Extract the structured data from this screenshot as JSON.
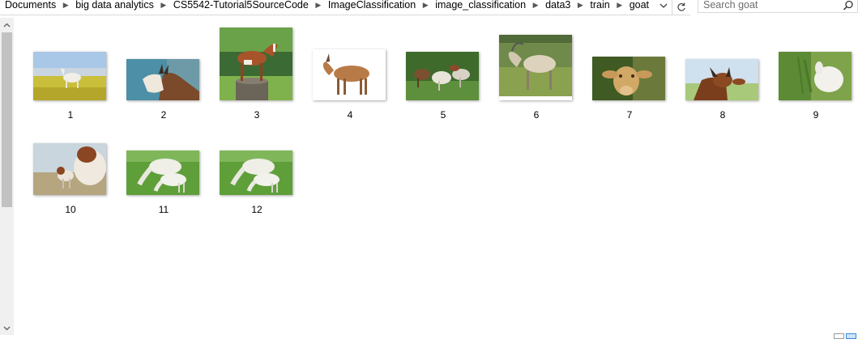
{
  "address": {
    "breadcrumbs": [
      "Documents",
      "big data analytics",
      "CS5542-Tutorial5SourceCode",
      "ImageClassification",
      "image_classification",
      "data3",
      "train",
      "goat"
    ]
  },
  "search": {
    "placeholder": "Search goat"
  },
  "files": [
    {
      "name": "1",
      "icon": "goat-on-meadow-thumbnail"
    },
    {
      "name": "2",
      "icon": "goat-head-thumbnail"
    },
    {
      "name": "3",
      "icon": "goat-on-stump-thumbnail"
    },
    {
      "name": "4",
      "icon": "brown-goat-thumbnail"
    },
    {
      "name": "5",
      "icon": "goat-group-thumbnail"
    },
    {
      "name": "6",
      "icon": "white-goat-thumbnail"
    },
    {
      "name": "7",
      "icon": "goat-face-thumbnail"
    },
    {
      "name": "8",
      "icon": "brown-goat-head-thumbnail"
    },
    {
      "name": "9",
      "icon": "white-goat-plants-thumbnail"
    },
    {
      "name": "10",
      "icon": "goat-kid-thumbnail"
    },
    {
      "name": "11",
      "icon": "two-goats-grazing-thumbnail"
    },
    {
      "name": "12",
      "icon": "two-goats-grazing-thumbnail"
    }
  ],
  "colors": {
    "background": "#ffffff",
    "scrollbar_track": "#f0f0f0",
    "scrollbar_thumb": "#c2c2c2",
    "border": "#d9d9d9",
    "view_button_active": "#cce4f7"
  }
}
